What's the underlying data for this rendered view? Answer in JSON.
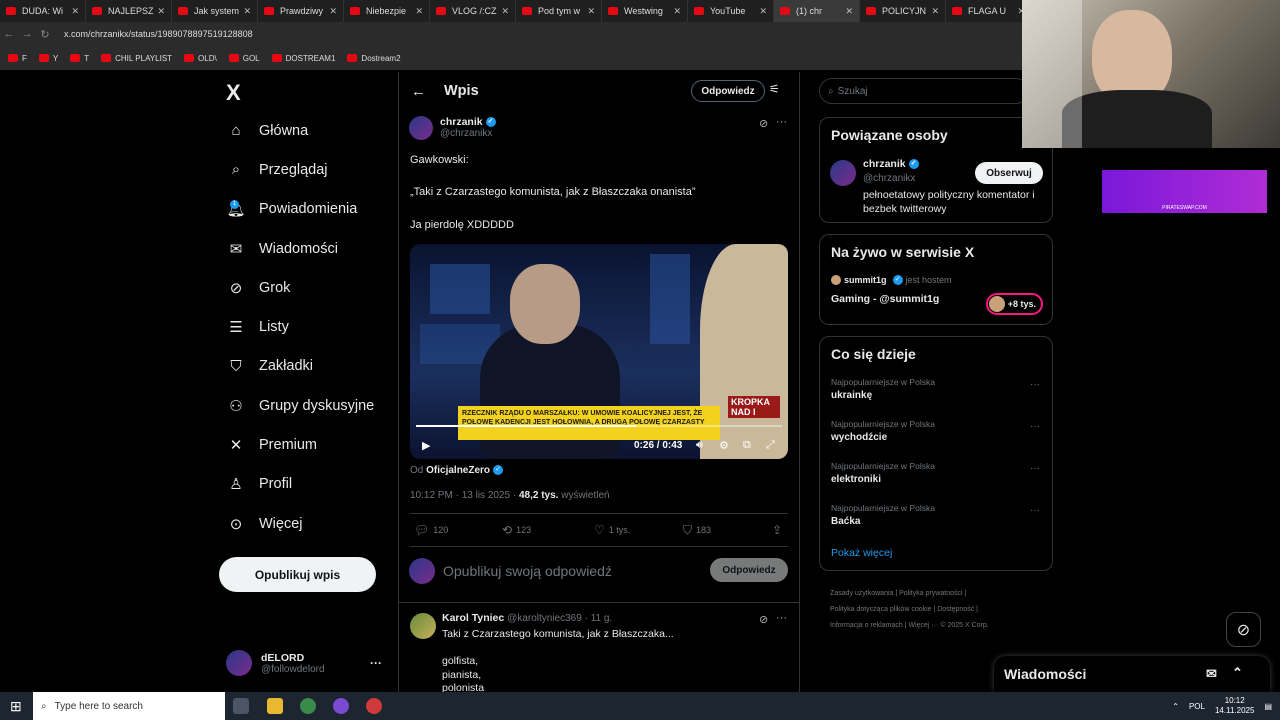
{
  "browser": {
    "tabs": [
      "DUDA: Wi",
      "NAJLEPSZ",
      "Jak system",
      "Prawdziwy",
      "Niebezpie",
      "VLOG /:CZ",
      "Pod tym w",
      "Westwing",
      "YouTube",
      "(1) chr",
      "POLICYJN",
      "FLAGA U"
    ],
    "url": "x.com/chrzanikx/status/1989078897519128808",
    "bookmarks": [
      "F",
      "Y",
      "T",
      "CHIL PLAYLIST",
      "OLD\\",
      "GOL",
      "DOSTREAM1",
      "Dostream2"
    ]
  },
  "nav": {
    "logo": "X",
    "items": [
      {
        "label": "Główna",
        "icon": "home-icon",
        "glyph": "⌂"
      },
      {
        "label": "Przeglądaj",
        "icon": "search-icon",
        "glyph": "⌕"
      },
      {
        "label": "Powiadomienia",
        "icon": "bell-icon",
        "glyph": "🔔︎"
      },
      {
        "label": "Wiadomości",
        "icon": "envelope-icon",
        "glyph": "✉"
      },
      {
        "label": "Grok",
        "icon": "grok-icon",
        "glyph": "⊘"
      },
      {
        "label": "Listy",
        "icon": "list-icon",
        "glyph": "☰"
      },
      {
        "label": "Zakładki",
        "icon": "bookmark-icon",
        "glyph": "⛉"
      },
      {
        "label": "Grupy dyskusyjne",
        "icon": "people-icon",
        "glyph": "⚇"
      },
      {
        "label": "Premium",
        "icon": "x-icon",
        "glyph": "✕"
      },
      {
        "label": "Profil",
        "icon": "person-icon",
        "glyph": "♙"
      },
      {
        "label": "Więcej",
        "icon": "more-icon",
        "glyph": "⊙"
      }
    ],
    "notif_count": "1",
    "publish": "Opublikuj wpis",
    "user": {
      "name": "dELORD",
      "handle": "@followdelord",
      "more": "···"
    }
  },
  "post": {
    "header_title": "Wpis",
    "header_reply": "Odpowiedz",
    "author_name": "chrzanik",
    "author_handle": "@chrzanikx",
    "line1": "Gawkowski:",
    "line2": "„Taki z Czarzastego komunista, jak z Błaszczaka onanista”",
    "line3": "Ja pierdolę XDDDDD",
    "video": {
      "banner": "RZECZNIK RZĄDU O MARSZAŁKU: W UMOWIE KOALICYJNEJ JEST, ŻE POŁOWĘ KADENCJI JEST HOŁOWNIA, A DRUGĄ POŁOWĘ CZARZASTY",
      "logo": "KROPKA NAD I",
      "time": "0:26 / 0:43",
      "progress": 0.6
    },
    "from_label": "Od",
    "from_name": "OficjalneZero",
    "meta_time": "10:12 PM · 13 lis 2025 · ",
    "views": "48,2 tys.",
    "views_label": " wyświetleń",
    "stats": {
      "replies": "120",
      "reposts": "123",
      "likes": "1 tys.",
      "bookmarks": "183"
    },
    "reply_placeholder": "Opublikuj swoją odpowiedź",
    "reply_button": "Odpowiedz"
  },
  "reply": {
    "name": "Karol Tyniec",
    "handle": "@karoltyniec369 · 11 g.",
    "text": "Taki z Czarzastego komunista, jak z Błaszczaka...",
    "lines": [
      "golfista,",
      "pianista,",
      "polonista"
    ]
  },
  "sidebar": {
    "search_placeholder": "Szukaj",
    "related_title": "Powiązane osoby",
    "related": {
      "name": "chrzanik",
      "handle": "@chrzanikx",
      "bio": "pełnoetatowy polityczny komentator i bezbek twitterowy",
      "follow": "Obserwuj"
    },
    "live_title": "Na żywo w serwisie X",
    "live": {
      "host": "summit1g",
      "host_label": "jest hostem",
      "title": "Gaming - @summit1g",
      "count": "+8 tys."
    },
    "trends_title": "Co się dzieje",
    "trends": [
      {
        "meta": "Najpopularniejsze w Polska",
        "name": "ukrainkę"
      },
      {
        "meta": "Najpopularniejsze w Polska",
        "name": "wychodźcie"
      },
      {
        "meta": "Najpopularniejsze w Polska",
        "name": "elektroniki"
      },
      {
        "meta": "Najpopularniejsze w Polska",
        "name": "Baćka"
      }
    ],
    "show_more": "Pokaż więcej",
    "footer1": "Zasady użytkowania   |   Polityka prywatności   |",
    "footer2": "Polityka dotycząca plików cookie   |   Dostępność   |",
    "footer3": "Informacja o reklamach   |   Więcej ···   © 2025 X Corp."
  },
  "dock": {
    "title": "Wiadomości"
  },
  "ad": {
    "text": "PIRATESWAP.COM"
  },
  "taskbar": {
    "search": "Type here to search",
    "lang": "POL",
    "time": "10:12",
    "date": "14.11.2025"
  },
  "colors": {
    "accent": "#1d9bf0",
    "bg": "#000000",
    "banner": "#f2d21c"
  }
}
